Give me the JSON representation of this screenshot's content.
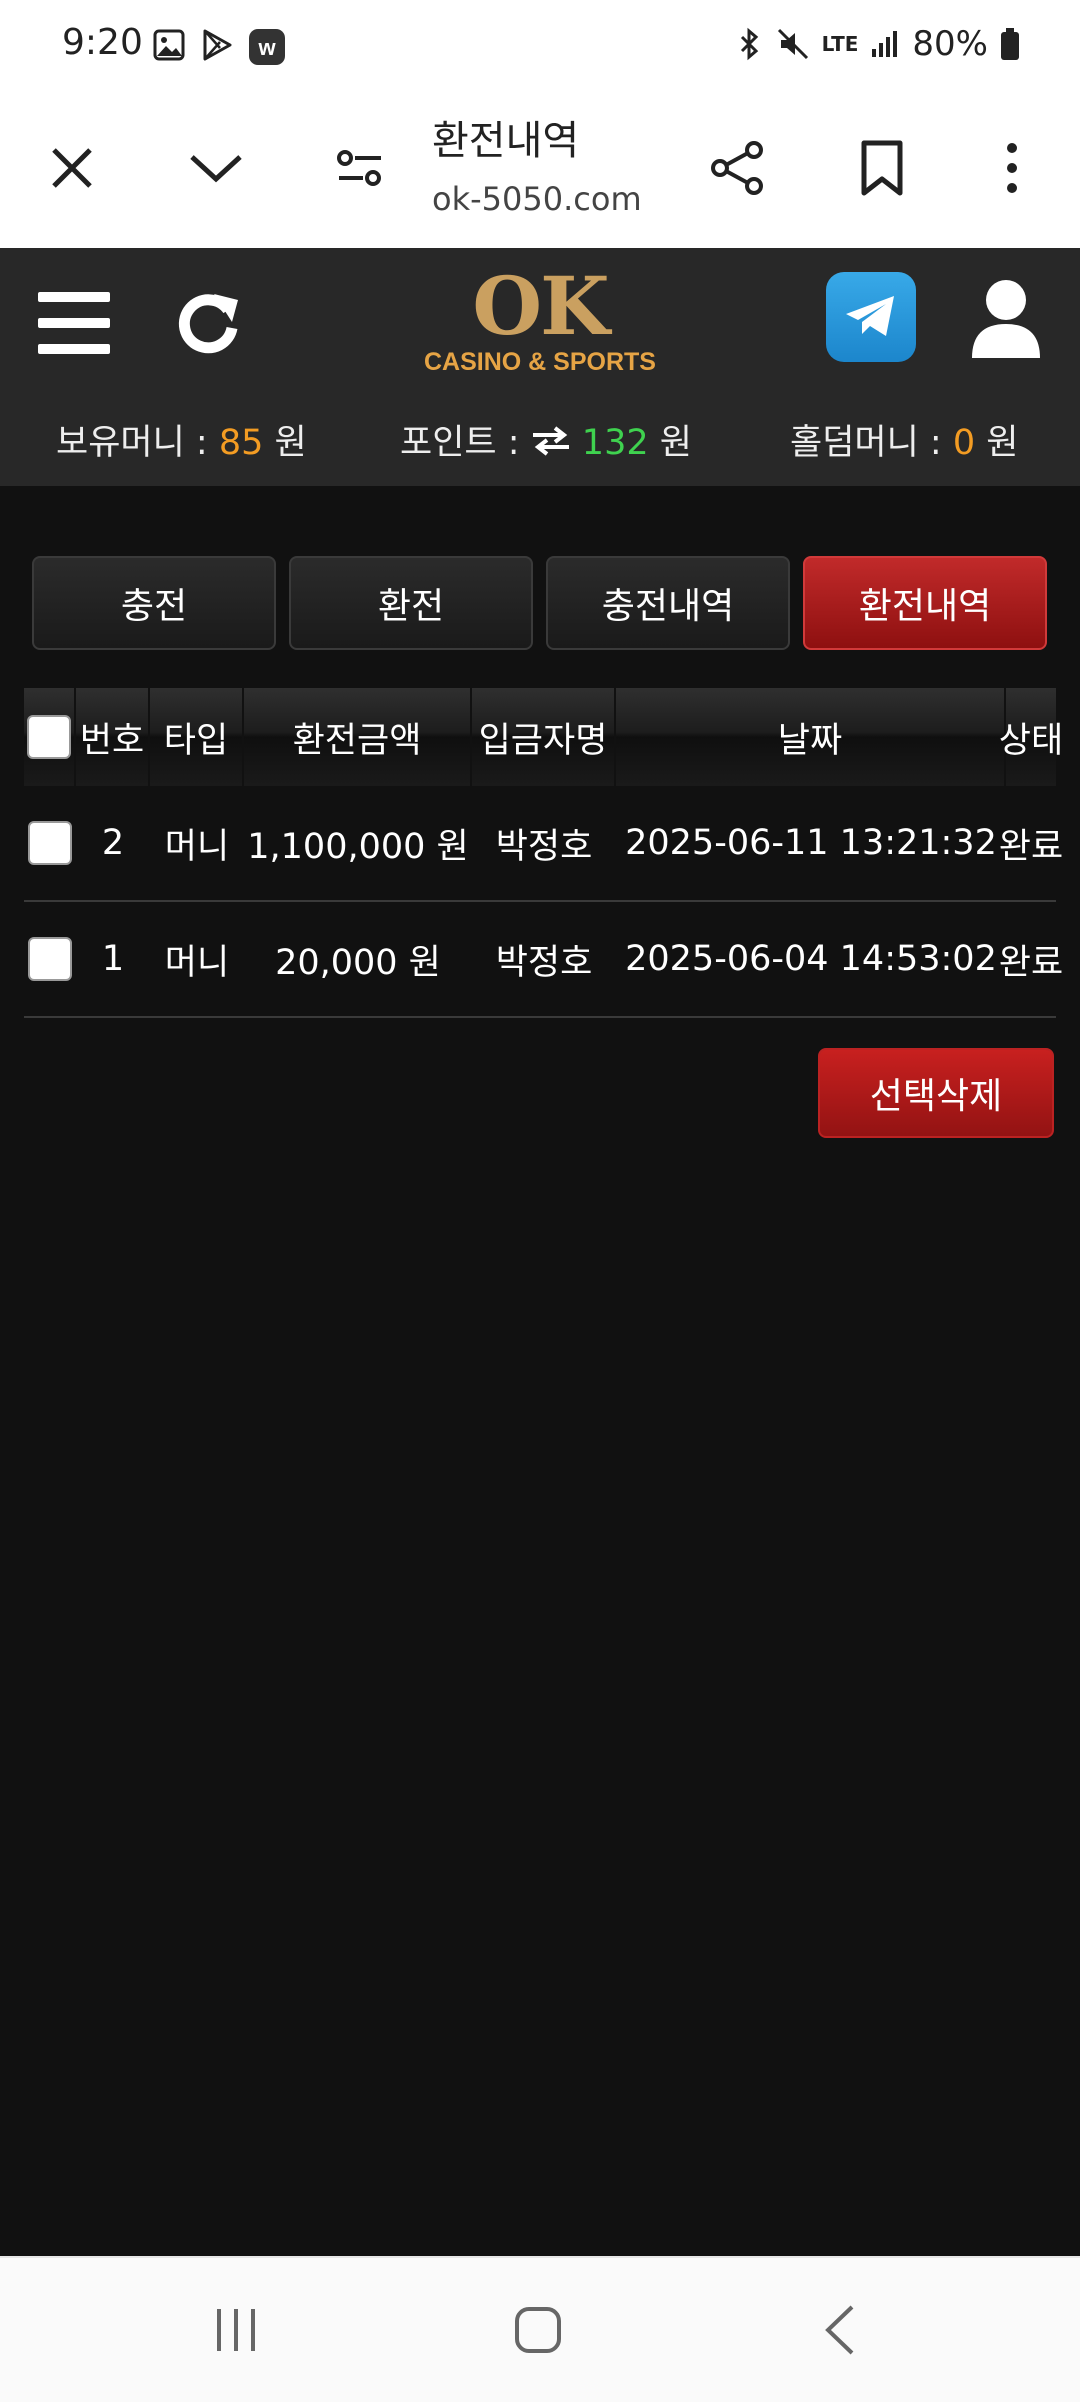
{
  "status_bar": {
    "time": "9:20",
    "battery": "80%",
    "network": "LTE",
    "icons": [
      "gallery-icon",
      "play-store-icon",
      "w-app-icon",
      "bluetooth-icon",
      "mute-icon",
      "signal-icon",
      "battery-icon"
    ]
  },
  "browser": {
    "title": "환전내역",
    "url": "ok-5050.com",
    "icons": [
      "close-icon",
      "chevron-down-icon",
      "site-settings-icon",
      "share-icon",
      "bookmark-icon",
      "more-icon"
    ]
  },
  "site": {
    "logo_main": "OK",
    "logo_sub": "CASINO & SPORTS",
    "money": {
      "held_label": "보유머니 : ",
      "held_value": "85",
      "points_label": "포인트 : ",
      "points_value": "132",
      "holdem_label": "홀덤머니 : ",
      "holdem_value": "0",
      "unit": "원"
    }
  },
  "tabs": [
    {
      "label": "충전",
      "active": false
    },
    {
      "label": "환전",
      "active": false
    },
    {
      "label": "충전내역",
      "active": false
    },
    {
      "label": "환전내역",
      "active": true
    }
  ],
  "table": {
    "headers": [
      "번호",
      "타입",
      "환전금액",
      "입금자명",
      "날짜",
      "상태"
    ],
    "rows": [
      {
        "no": "2",
        "type": "머니",
        "amount": "1,100,000 원",
        "name": "박정호",
        "date": "2025-06-11 13:21:32",
        "status": "완료"
      },
      {
        "no": "1",
        "type": "머니",
        "amount": "20,000 원",
        "name": "박정호",
        "date": "2025-06-04 14:53:02",
        "status": "완료"
      }
    ]
  },
  "delete_button": "선택삭제",
  "colors": {
    "accent_red": "#b81c1c",
    "money_orange": "#f39c23",
    "points_green": "#3fd24f",
    "telegram_blue": "#2a9be0"
  }
}
